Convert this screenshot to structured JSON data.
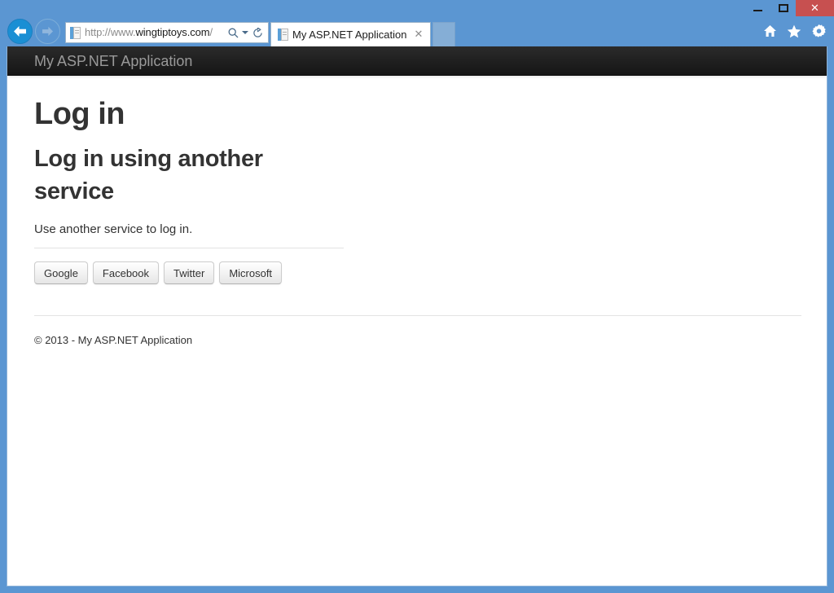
{
  "browser": {
    "window_controls": {
      "minimize": "–",
      "maximize": "□",
      "close": "✕"
    },
    "back_icon": "back-arrow-icon",
    "forward_icon": "forward-arrow-icon",
    "address": {
      "url_scheme": "http://www.",
      "url_host": "wingtiptoys.com",
      "url_path": "/",
      "full_url": "http://www.wingtiptoys.com/",
      "search_icon": "search-icon",
      "dropdown_icon": "chevron-down-icon",
      "refresh_icon": "refresh-icon"
    },
    "tab": {
      "title": "My ASP.NET Application",
      "close_label": "✕",
      "favicon": "page-icon"
    },
    "new_tab_label": "",
    "toolbar_icons": [
      {
        "name": "home-icon",
        "glyph": "⌂"
      },
      {
        "name": "favorites-icon",
        "glyph": "★"
      },
      {
        "name": "settings-icon",
        "glyph": "⚙"
      }
    ],
    "colors": {
      "frame": "#5b96d2",
      "close_button": "#c75050",
      "back_button": "#1a8fd4"
    }
  },
  "page": {
    "navbar": {
      "brand": "My ASP.NET Application",
      "background": "#222222"
    },
    "title": "Log in",
    "section": {
      "heading": "Log in using another service",
      "description": "Use another service to log in.",
      "providers": [
        {
          "label": "Google"
        },
        {
          "label": "Facebook"
        },
        {
          "label": "Twitter"
        },
        {
          "label": "Microsoft"
        }
      ]
    },
    "footer": {
      "copyright": "© 2013 - My ASP.NET Application"
    }
  }
}
